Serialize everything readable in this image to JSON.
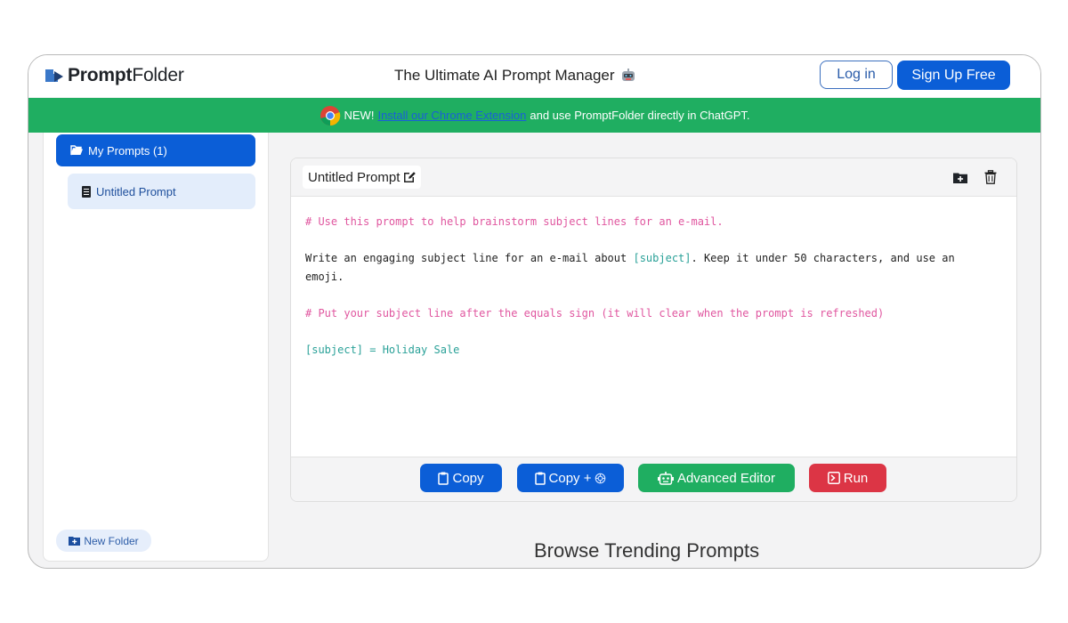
{
  "header": {
    "logo_bold": "Prompt",
    "logo_regular": "Folder",
    "tagline": "The Ultimate AI Prompt Manager",
    "login_label": "Log in",
    "signup_label": "Sign Up Free"
  },
  "banner": {
    "new_label": "NEW!",
    "link_text": "Install our Chrome Extension",
    "rest_text": "and use PromptFolder directly in ChatGPT."
  },
  "sidebar": {
    "folder_label": "My Prompts (1)",
    "prompt_item_label": "Untitled Prompt",
    "new_folder_label": "New Folder"
  },
  "editor": {
    "title": "Untitled Prompt",
    "lines": {
      "comment1": "# Use this prompt to help brainstorm subject lines for an e-mail.",
      "body_prefix": "Write an engaging subject line for an e-mail about ",
      "body_var": "[subject]",
      "body_suffix": ". Keep it under 50 characters, and use an",
      "body_line2": "emoji.",
      "comment2": "# Put your subject line after the equals sign (it will clear when the prompt is refreshed)",
      "assignment": "[subject] = Holiday Sale"
    }
  },
  "footer_buttons": {
    "copy": "Copy",
    "copy_plus": "Copy +",
    "advanced": "Advanced Editor",
    "run": "Run"
  },
  "browse_heading": "Browse Trending Prompts",
  "colors": {
    "primary": "#0b5ed7",
    "success": "#1fae61",
    "danger": "#dc3545",
    "comment": "#e0569f",
    "variable": "#2aa198"
  }
}
